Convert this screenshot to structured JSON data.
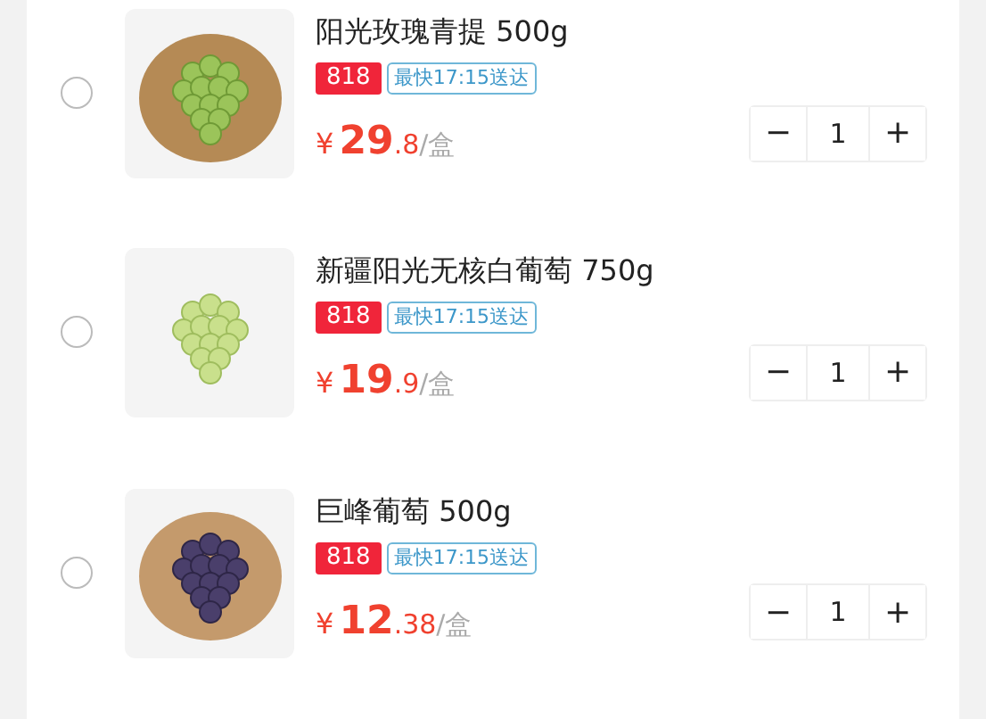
{
  "items": [
    {
      "selected": false,
      "kind": "green",
      "title": "阳光玫瑰青提 500g",
      "promo_tag": "818",
      "delivery_tag": "最快17:15送达",
      "currency": "¥",
      "price_integer": "29",
      "price_decimal": ".8",
      "price_unit": "/盒",
      "minus": "−",
      "quantity": "1",
      "plus": "+"
    },
    {
      "selected": false,
      "kind": "pale",
      "title": "新疆阳光无核白葡萄 750g",
      "promo_tag": "818",
      "delivery_tag": "最快17:15送达",
      "currency": "¥",
      "price_integer": "19",
      "price_decimal": ".9",
      "price_unit": "/盒",
      "minus": "−",
      "quantity": "1",
      "plus": "+"
    },
    {
      "selected": false,
      "kind": "purple",
      "title": "巨峰葡萄 500g",
      "promo_tag": "818",
      "delivery_tag": "最快17:15送达",
      "currency": "¥",
      "price_integer": "12",
      "price_decimal": ".38",
      "price_unit": "/盒",
      "minus": "−",
      "quantity": "1",
      "plus": "+"
    }
  ]
}
